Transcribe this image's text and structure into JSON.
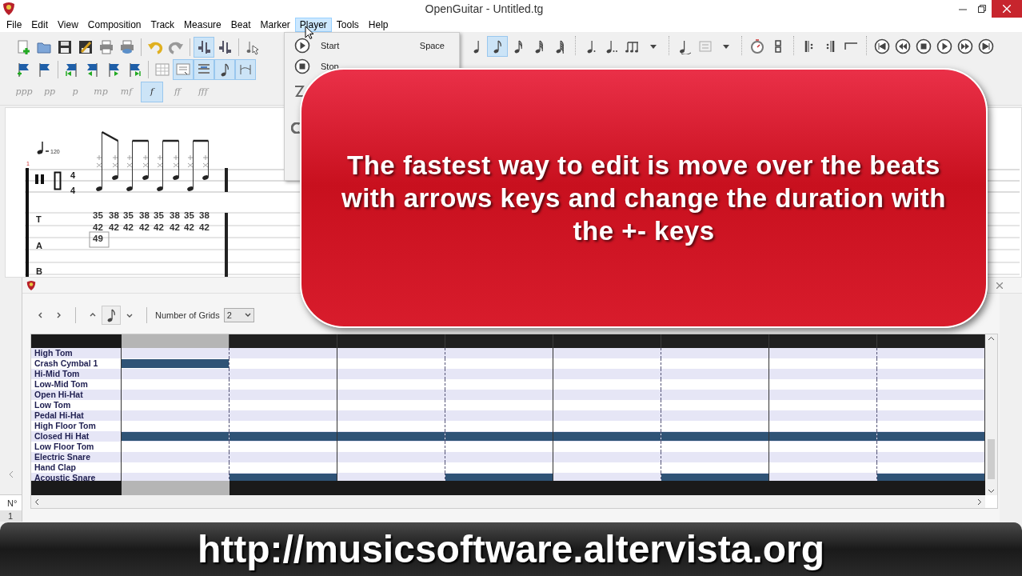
{
  "window": {
    "title": "OpenGuitar - Untitled.tg"
  },
  "menu_bar": [
    {
      "label": "File",
      "selected": false
    },
    {
      "label": "Edit",
      "selected": false
    },
    {
      "label": "View",
      "selected": false
    },
    {
      "label": "Composition",
      "selected": false
    },
    {
      "label": "Track",
      "selected": false
    },
    {
      "label": "Measure",
      "selected": false
    },
    {
      "label": "Beat",
      "selected": false
    },
    {
      "label": "Marker",
      "selected": false
    },
    {
      "label": "Player",
      "selected": true
    },
    {
      "label": "Tools",
      "selected": false
    },
    {
      "label": "Help",
      "selected": false
    }
  ],
  "player_menu": {
    "items": [
      {
        "label": "Start",
        "shortcut": "Space",
        "kind": "play"
      },
      {
        "label": "Stop",
        "kind": "stop"
      }
    ]
  },
  "toolbar_rows": [
    [
      [
        {
          "kind": "new",
          "selected": false
        },
        {
          "kind": "open",
          "selected": false
        },
        {
          "kind": "save",
          "selected": false
        },
        {
          "kind": "saveas",
          "selected": false
        },
        {
          "kind": "print",
          "selected": false
        },
        {
          "kind": "preview",
          "selected": false
        }
      ],
      [
        {
          "kind": "undo",
          "selected": false
        },
        {
          "kind": "redo",
          "selected": false
        }
      ],
      [
        {
          "kind": "track",
          "selected": true
        },
        {
          "kind": "track",
          "selected": false
        }
      ],
      [
        {
          "kind": "pointer",
          "selected": false
        }
      ]
    ],
    [
      [
        {
          "kind": "flagadd",
          "selected": false
        },
        {
          "kind": "flag",
          "selected": false
        }
      ],
      [
        {
          "kind": "flagfirst",
          "selected": false
        },
        {
          "kind": "flagprev",
          "selected": false
        },
        {
          "kind": "flagnext",
          "selected": false
        },
        {
          "kind": "flaglast",
          "selected": false
        }
      ],
      [
        {
          "kind": "grid",
          "selected": false
        },
        {
          "kind": "layout",
          "selected": true
        },
        {
          "kind": "lines",
          "selected": true
        },
        {
          "kind": "note",
          "selected": true
        },
        {
          "kind": "chord",
          "selected": true
        }
      ]
    ]
  ],
  "dynamics": [
    {
      "label": "ppp",
      "selected": false
    },
    {
      "label": "pp",
      "selected": false
    },
    {
      "label": "p",
      "selected": false
    },
    {
      "label": "mp",
      "selected": false
    },
    {
      "label": "mf",
      "selected": false
    },
    {
      "label": "f",
      "selected": true
    },
    {
      "label": "ff",
      "selected": false
    },
    {
      "label": "fff",
      "selected": false
    }
  ],
  "duration_toolbar": [
    [
      {
        "kind": "quarter",
        "selected": false
      },
      {
        "kind": "eighth",
        "selected": true
      },
      {
        "kind": "sixteenth",
        "selected": false
      },
      {
        "kind": "thirtysecond",
        "selected": false
      },
      {
        "kind": "sixtyfourth",
        "selected": false
      }
    ],
    [
      {
        "kind": "dotted",
        "selected": false
      },
      {
        "kind": "doubledotted",
        "selected": false
      },
      {
        "kind": "tuplet",
        "selected": false
      },
      {
        "kind": "caret",
        "selected": false
      }
    ],
    [
      {
        "kind": "tie",
        "selected": false
      },
      {
        "kind": "chordbox",
        "selected": false
      },
      {
        "kind": "caret",
        "selected": false
      }
    ],
    [
      {
        "kind": "metronome",
        "selected": false
      },
      {
        "kind": "timesig",
        "selected": false
      }
    ],
    [
      {
        "kind": "repeatopen",
        "selected": false
      },
      {
        "kind": "repeatclose",
        "selected": false
      },
      {
        "kind": "ending",
        "selected": false
      }
    ],
    [
      {
        "kind": "first",
        "selected": false
      },
      {
        "kind": "rewind",
        "selected": false
      },
      {
        "kind": "stop",
        "selected": false
      },
      {
        "kind": "play",
        "selected": false
      },
      {
        "kind": "forward",
        "selected": false
      },
      {
        "kind": "last",
        "selected": false
      }
    ]
  ],
  "score": {
    "measure_number": "1",
    "tempo": "120",
    "time_signature": [
      "4",
      "4"
    ],
    "string_labels": [
      "T",
      "A",
      "B"
    ],
    "beats": [
      {
        "notes": [
          {
            "fret": "35",
            "selected": false
          },
          {
            "fret": "42",
            "selected": false
          },
          {
            "fret": "49",
            "selected": true
          }
        ]
      },
      {
        "notes": [
          {
            "fret": "38",
            "selected": false
          },
          {
            "fret": "42",
            "selected": false
          }
        ]
      },
      {
        "notes": [
          {
            "fret": "35",
            "selected": false
          },
          {
            "fret": "42",
            "selected": false
          }
        ]
      },
      {
        "notes": [
          {
            "fret": "38",
            "selected": false
          },
          {
            "fret": "42",
            "selected": false
          }
        ]
      },
      {
        "notes": [
          {
            "fret": "35",
            "selected": false
          },
          {
            "fret": "42",
            "selected": false
          }
        ]
      },
      {
        "notes": [
          {
            "fret": "38",
            "selected": false
          },
          {
            "fret": "42",
            "selected": false
          }
        ]
      },
      {
        "notes": [
          {
            "fret": "35",
            "selected": false
          },
          {
            "fret": "42",
            "selected": false
          }
        ]
      },
      {
        "notes": [
          {
            "fret": "38",
            "selected": false
          },
          {
            "fret": "42",
            "selected": false
          }
        ]
      }
    ]
  },
  "drum_editor": {
    "grids_label": "Number of Grids",
    "grids_value": "2",
    "columns": [
      {
        "selected": true
      },
      {
        "selected": false
      },
      {
        "selected": false
      },
      {
        "selected": false
      },
      {
        "selected": false
      },
      {
        "selected": false
      },
      {
        "selected": false
      },
      {
        "selected": false
      }
    ],
    "rows": [
      {
        "name": "High Tom",
        "hits": [
          false,
          false,
          false,
          false,
          false,
          false,
          false,
          false
        ]
      },
      {
        "name": "Crash Cymbal 1",
        "hits": [
          true,
          false,
          false,
          false,
          false,
          false,
          false,
          false
        ]
      },
      {
        "name": "Hi-Mid Tom",
        "hits": [
          false,
          false,
          false,
          false,
          false,
          false,
          false,
          false
        ]
      },
      {
        "name": "Low-Mid Tom",
        "hits": [
          false,
          false,
          false,
          false,
          false,
          false,
          false,
          false
        ]
      },
      {
        "name": "Open Hi-Hat",
        "hits": [
          false,
          false,
          false,
          false,
          false,
          false,
          false,
          false
        ]
      },
      {
        "name": "Low Tom",
        "hits": [
          false,
          false,
          false,
          false,
          false,
          false,
          false,
          false
        ]
      },
      {
        "name": "Pedal Hi-Hat",
        "hits": [
          false,
          false,
          false,
          false,
          false,
          false,
          false,
          false
        ]
      },
      {
        "name": "High Floor Tom",
        "hits": [
          false,
          false,
          false,
          false,
          false,
          false,
          false,
          false
        ]
      },
      {
        "name": "Closed Hi Hat",
        "hits": [
          true,
          true,
          true,
          true,
          true,
          true,
          true,
          true
        ]
      },
      {
        "name": "Low Floor Tom",
        "hits": [
          false,
          false,
          false,
          false,
          false,
          false,
          false,
          false
        ]
      },
      {
        "name": "Electric Snare",
        "hits": [
          false,
          false,
          false,
          false,
          false,
          false,
          false,
          false
        ]
      },
      {
        "name": "Hand Clap",
        "hits": [
          false,
          false,
          false,
          false,
          false,
          false,
          false,
          false
        ]
      },
      {
        "name": "Acoustic Snare",
        "hits": [
          false,
          true,
          false,
          true,
          false,
          true,
          false,
          true
        ]
      }
    ]
  },
  "side_table": {
    "header": "N°",
    "value": "1"
  },
  "callout": "The fastest way to edit is move over the beats with arrows keys and change the duration with the +- keys",
  "banner": "http://musicsoftware.altervista.org"
}
